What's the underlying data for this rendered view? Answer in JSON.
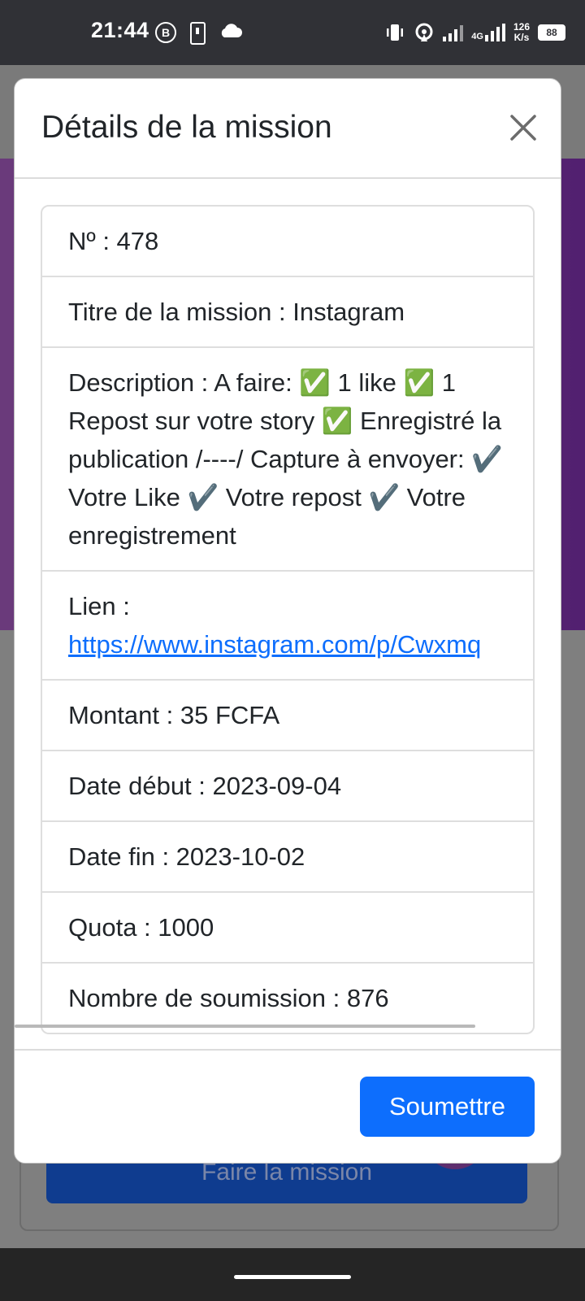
{
  "status_bar": {
    "time": "21:44",
    "b_icon_label": "B",
    "network": "4G",
    "speed": "126\nK/s",
    "battery": "88"
  },
  "background": {
    "button_label": "Faire la mission"
  },
  "modal": {
    "title": "Détails de la mission",
    "rows": {
      "number": "Nº : 478",
      "title": "Titre de la mission : Instagram",
      "description": "Description : A faire: ✅ 1 like ✅ 1 Repost sur votre story ✅ Enregistré la publication /----/ Capture à envoyer: ✔️ Votre Like ✔️ Votre repost ✔️ Votre enregistrement",
      "link_label": "Lien :",
      "link_url": "https://www.instagram.com/p/Cwxmq",
      "amount": "Montant : 35 FCFA",
      "start_date": "Date début : 2023-09-04",
      "end_date": "Date fin : 2023-10-02",
      "quota": "Quota : 1000",
      "submissions": "Nombre de soumission : 876"
    },
    "submit_label": "Soumettre"
  }
}
